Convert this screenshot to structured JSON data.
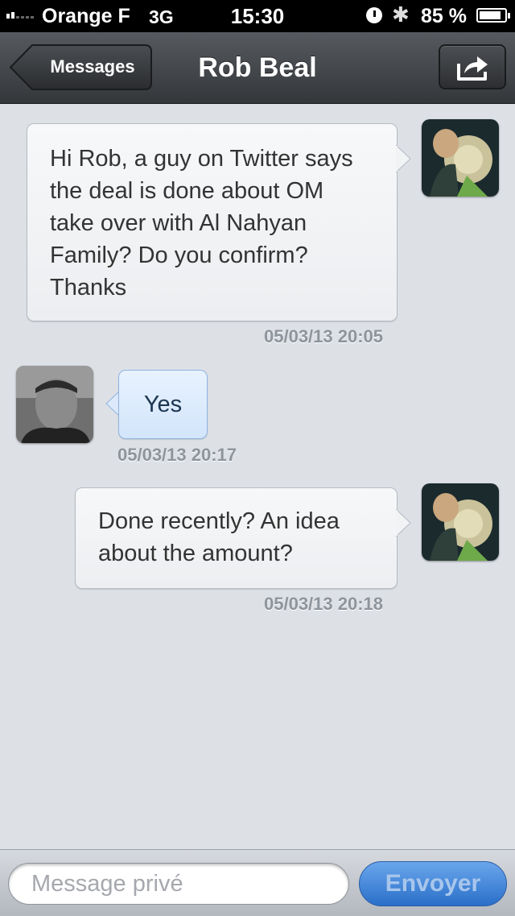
{
  "status_bar": {
    "carrier": "Orange F",
    "network": "3G",
    "time": "15:30",
    "battery": "85 %"
  },
  "nav": {
    "back_label": "Messages",
    "title": "Rob Beal",
    "share_icon": "share-icon"
  },
  "messages": [
    {
      "side": "right",
      "text": "Hi Rob, a guy on Twitter says the deal is done about OM take over with Al Nahyan Family? Do you confirm? Thanks",
      "timestamp": "05/03/13 20:05"
    },
    {
      "side": "left",
      "text": "Yes",
      "timestamp": "05/03/13 20:17"
    },
    {
      "side": "right",
      "text": "Done recently? An idea about the amount?",
      "timestamp": "05/03/13 20:18"
    }
  ],
  "composer": {
    "placeholder": "Message privé",
    "value": "",
    "send_label": "Envoyer"
  },
  "colors": {
    "background": "#dde1e6",
    "outgoing_bubble": "#eceef1",
    "incoming_bubble": "#d2e5fb",
    "send_button": "#2a6fc8"
  }
}
